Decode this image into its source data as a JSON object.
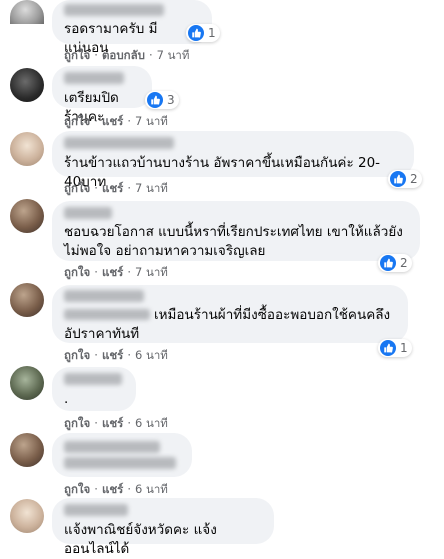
{
  "comments": [
    {
      "text": "รอดรามาครับ มีแน่นอน",
      "reaction_count": "1",
      "actions": {
        "like": "ถูกใจ",
        "reply": "ตอบกลับ",
        "time": "7 นาที"
      }
    },
    {
      "text": "เตรียมปิดร้านคะ",
      "reaction_count": "3",
      "actions": {
        "like": "ถูกใจ",
        "reply": "แชร์",
        "time": "7 นาที"
      }
    },
    {
      "text": "ร้านข้าวแถวบ้านบางร้าน อัพราคาขึ้นเหมือนกันค่ะ 20-40บาท",
      "reaction_count": "2",
      "actions": {
        "like": "ถูกใจ",
        "reply": "แชร์",
        "time": "7 นาที"
      }
    },
    {
      "text": "ชอบฉวยโอกาส แบบนี้หราที่เรียกประเทศไทย เขาให้แล้วยังไม่พอใจ อย่าถามหาความเจริญเลย",
      "reaction_count": "2",
      "actions": {
        "like": "ถูกใจ",
        "reply": "แชร์",
        "time": "7 นาที"
      }
    },
    {
      "text": "เหมือนร้านผ้าที่มีงซื้ออะพอบอกใช้คนคลึง อัปราคาทันที",
      "reaction_count": "1",
      "actions": {
        "like": "ถูกใจ",
        "reply": "แชร์",
        "time": "6 นาที"
      }
    },
    {
      "text": ".",
      "actions": {
        "like": "ถูกใจ",
        "reply": "แชร์",
        "time": "6 นาที"
      }
    },
    {
      "text": "",
      "actions": {
        "like": "ถูกใจ",
        "reply": "แชร์",
        "time": "6 นาที"
      }
    },
    {
      "text": "แจ้งพาณิชย์จังหวัดคะ แจ้งออนไลน์ได้"
    }
  ],
  "colors": {
    "bubble": "#f0f2f5",
    "like_blue": "#1877f2",
    "meta_gray": "#65676b",
    "text": "#050505"
  },
  "icons": {
    "reaction": "like-thumb-icon"
  }
}
